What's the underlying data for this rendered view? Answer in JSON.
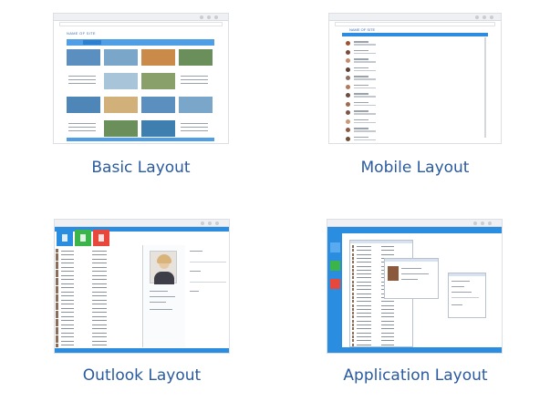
{
  "cards": {
    "basic": {
      "label": "Basic Layout",
      "site_title": "NAME OF SITE"
    },
    "mobile": {
      "label": "Mobile Layout",
      "site_title": "NAME OF SITE"
    },
    "outlook": {
      "label": "Outlook Layout"
    },
    "application": {
      "label": "Application Layout"
    }
  },
  "colors": {
    "label_text": "#2a5aa0",
    "accent_blue": "#2b8de0",
    "tile_green": "#3bb44a",
    "tile_red": "#e8473c"
  }
}
